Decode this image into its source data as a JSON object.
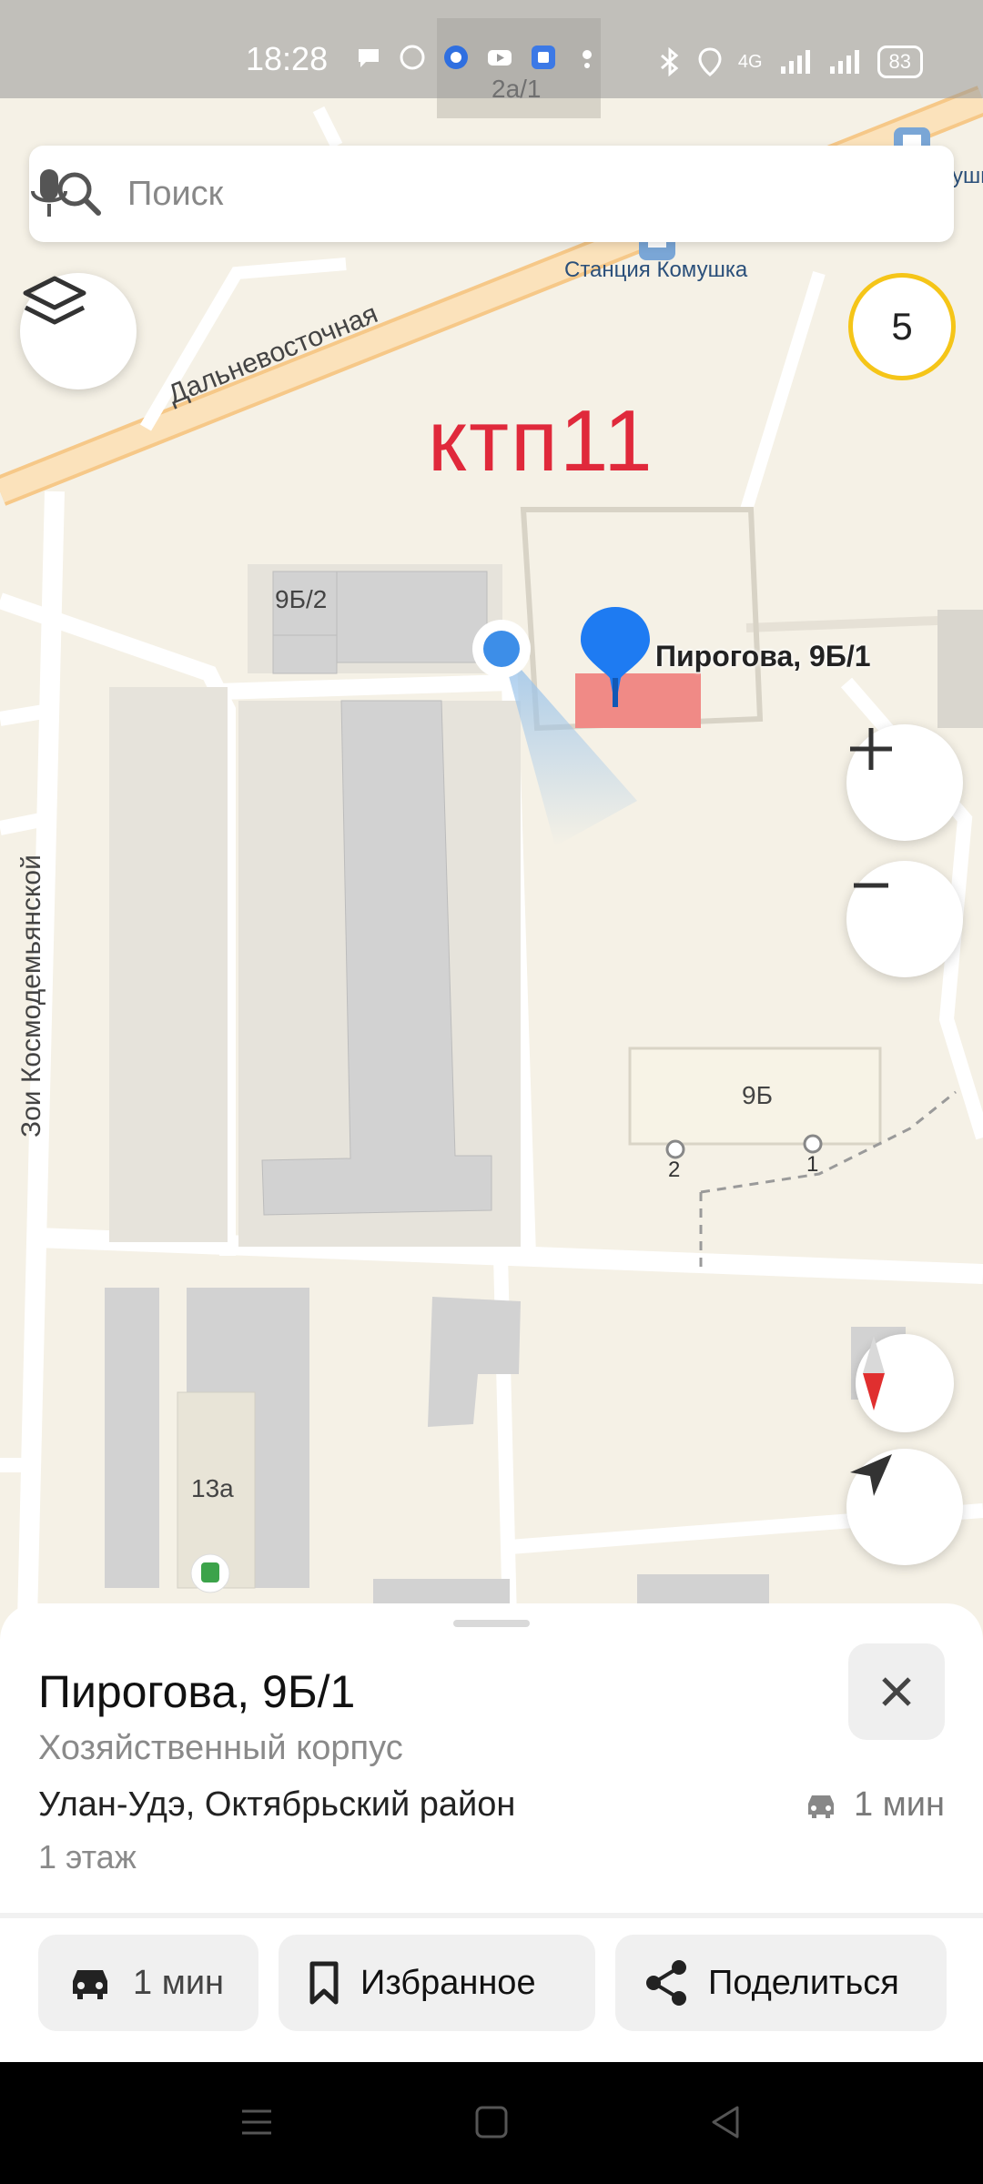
{
  "status_bar": {
    "time": "18:28",
    "network": "4G",
    "battery": "83"
  },
  "search": {
    "placeholder": "Поиск"
  },
  "traffic": {
    "level": "5"
  },
  "map": {
    "overlay_label": "ктп11",
    "selected_poi_label": "Пирогова, 9Б/1",
    "street_labels": [
      "Дальневосточная",
      "Зои Космодемьянской"
    ],
    "stop_label": "Станция Комушка",
    "stop_label_right": "ушк",
    "building_labels": [
      "2а/1",
      "9Б/2",
      "9Б",
      "13а"
    ],
    "entrance_labels": [
      "2",
      "1"
    ]
  },
  "sheet": {
    "title": "Пирогова, 9Б/1",
    "subtitle": "Хозяйственный корпус",
    "address": "Улан-Удэ, Октябрьский район",
    "floors": "1 этаж",
    "eta": "1 мин"
  },
  "actions": {
    "route_label": "1 мин",
    "favorites_label": "Избранное",
    "share_label": "Поделиться"
  },
  "colors": {
    "accent": "#1e7bf2",
    "overlay": "#e0293b",
    "building_selected": "#f08a86",
    "traffic_ring": "#f5c518"
  }
}
